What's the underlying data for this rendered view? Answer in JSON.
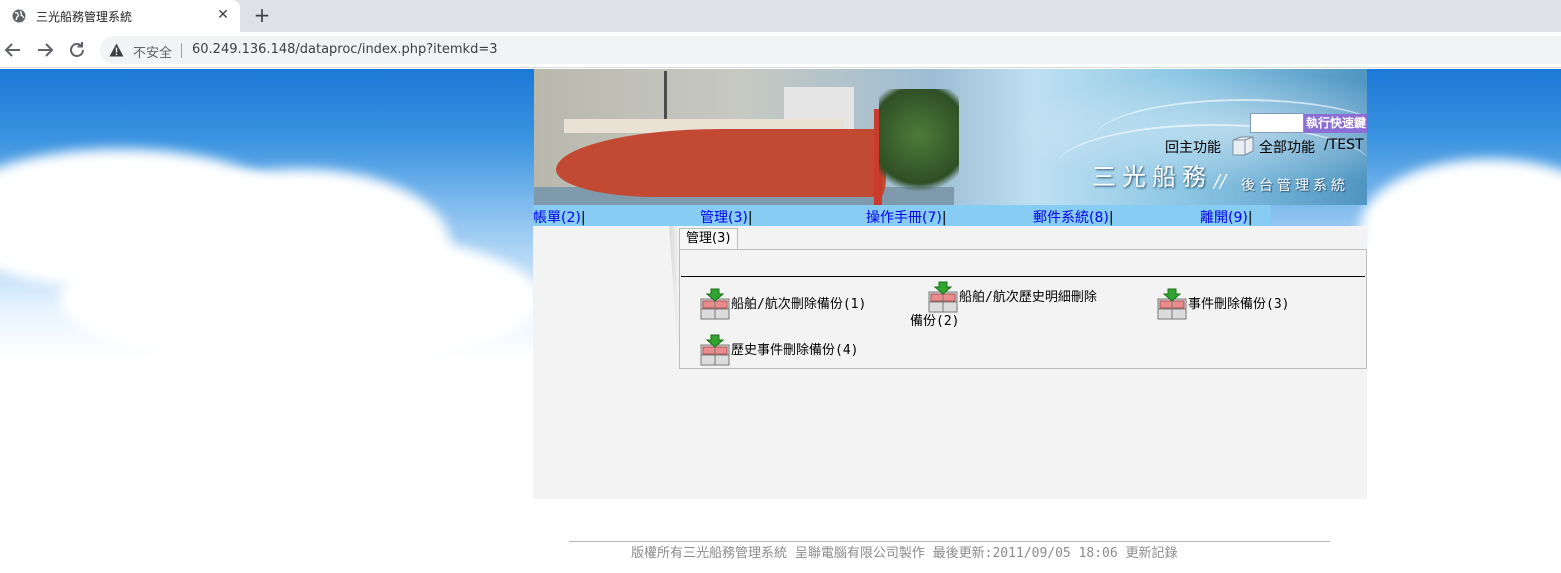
{
  "browser": {
    "tab_title": "三光船務管理系統",
    "tab_close": "✕",
    "new_tab": "+",
    "insecure_label": "不安全",
    "url": "60.249.136.148/dataproc/index.php?itemkd=3"
  },
  "header": {
    "quick_input_value": "",
    "quick_button": "執行快速鍵",
    "main_functions": "回主功能",
    "all_functions": "全部功能",
    "user": "/TEST",
    "brand_title": "三光船務",
    "brand_slash": "//",
    "brand_subtitle": "後台管理系統"
  },
  "menu": {
    "items": [
      {
        "label": "帳單(2)",
        "sep": "|"
      },
      {
        "label": "管理(3)",
        "sep": "|"
      },
      {
        "label": "操作手冊(7)",
        "sep": "|"
      },
      {
        "label": "郵件系統(8)",
        "sep": "|"
      },
      {
        "label": "離開(9)",
        "sep": "|"
      }
    ]
  },
  "panel": {
    "tab_label": "管理(3)",
    "items": [
      {
        "line1": "船舶/航次刪除備份(1)",
        "line2": ""
      },
      {
        "line1": "船舶/航次歷史明細刪除",
        "line2": "備份(2)"
      },
      {
        "line1": "事件刪除備份(3)",
        "line2": ""
      },
      {
        "line1": "歷史事件刪除備份(4)",
        "line2": ""
      }
    ]
  },
  "footer": {
    "text": "版權所有三光船務管理系統 呈聯電腦有限公司製作 最後更新:2011/09/05 18:06",
    "link": "更新記錄"
  },
  "colors": {
    "menubar": "#87cdf3",
    "link": "#0000ee",
    "quick_button": "#8b6fd6",
    "content_bg": "#f3f3f3"
  }
}
